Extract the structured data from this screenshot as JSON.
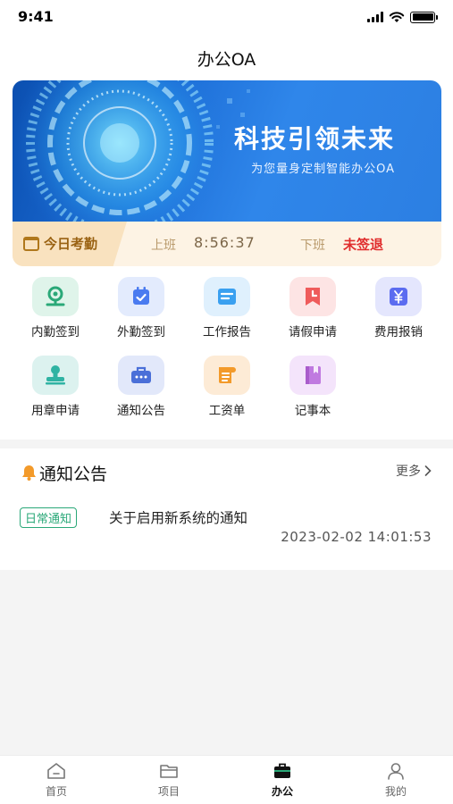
{
  "status_bar": {
    "time": "9:41"
  },
  "navbar": {
    "title": "办公OA"
  },
  "banner": {
    "title": "科技引领未来",
    "subtitle": "为您量身定制智能办公OA"
  },
  "attendance": {
    "tag": "今日考勤",
    "on_label": "上班",
    "on_time": "8:56:37",
    "off_label": "下班",
    "off_status": "未签退",
    "colors": {
      "off_status": "#e02d2d"
    }
  },
  "grid": [
    {
      "label": "内勤签到",
      "icon": "location-pin-icon",
      "color": "#2aa878"
    },
    {
      "label": "外勤签到",
      "icon": "calendar-check-icon",
      "color": "#4a7bf0"
    },
    {
      "label": "工作报告",
      "icon": "report-icon",
      "color": "#3aa0f0"
    },
    {
      "label": "请假申请",
      "icon": "clock-document-icon",
      "color": "#ef5b5b"
    },
    {
      "label": "费用报销",
      "icon": "yen-icon",
      "color": "#5b6cf0"
    },
    {
      "label": "用章申请",
      "icon": "stamp-icon",
      "color": "#2fb3a3"
    },
    {
      "label": "通知公告",
      "icon": "briefcase-icon",
      "color": "#4a6fd8"
    },
    {
      "label": "工资单",
      "icon": "payslip-icon",
      "color": "#f39a2a"
    },
    {
      "label": "记事本",
      "icon": "notebook-icon",
      "color": "#c07ae0"
    }
  ],
  "notice": {
    "title": "通知公告",
    "more": "更多",
    "items": [
      {
        "tag": "日常通知",
        "text": "关于启用新系统的通知",
        "time": "2023-02-02 14:01:53"
      }
    ]
  },
  "tabbar": [
    {
      "label": "首页",
      "icon": "home-icon",
      "active": false
    },
    {
      "label": "项目",
      "icon": "folder-icon",
      "active": false
    },
    {
      "label": "办公",
      "icon": "briefcase-icon",
      "active": true
    },
    {
      "label": "我的",
      "icon": "person-icon",
      "active": false
    }
  ]
}
